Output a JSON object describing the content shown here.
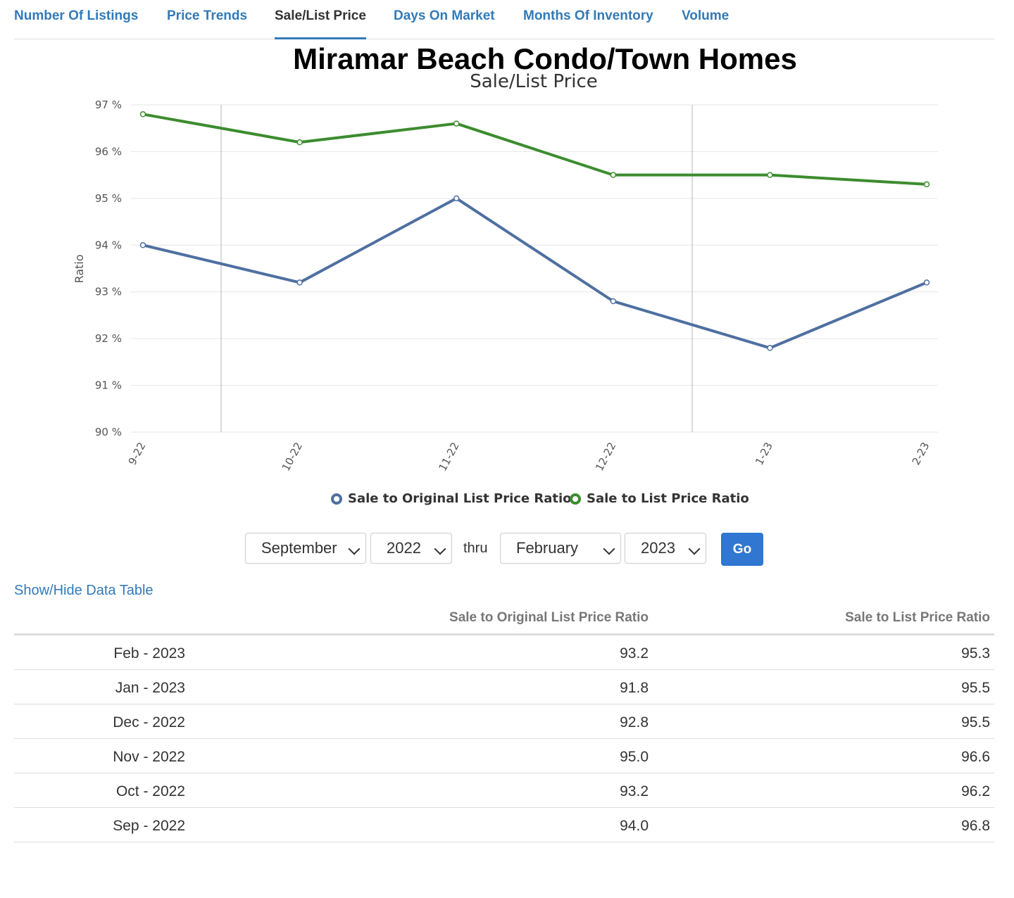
{
  "tabs": [
    {
      "label": "Number Of Listings",
      "active": false
    },
    {
      "label": "Price Trends",
      "active": false
    },
    {
      "label": "Sale/List Price",
      "active": true
    },
    {
      "label": "Days On Market",
      "active": false
    },
    {
      "label": "Months Of Inventory",
      "active": false
    },
    {
      "label": "Volume",
      "active": false
    }
  ],
  "chart_data": {
    "type": "line",
    "title": "Miramar Beach Condo/Town Homes",
    "subtitle": "Sale/List Price",
    "ylabel": "Ratio",
    "xlabel": "",
    "ylim": [
      90,
      97
    ],
    "y_ticks": [
      "90 %",
      "91 %",
      "92 %",
      "93 %",
      "94 %",
      "95 %",
      "96 %",
      "97 %"
    ],
    "categories": [
      "9-22",
      "10-22",
      "11-22",
      "12-22",
      "1-23",
      "2-23"
    ],
    "series": [
      {
        "name": "Sale to Original List Price Ratio",
        "color": "#4e6fa0",
        "values": [
          94.0,
          93.2,
          95.0,
          92.8,
          91.8,
          93.2
        ]
      },
      {
        "name": "Sale to List Price Ratio",
        "color": "#3c8c2e",
        "values": [
          96.8,
          96.2,
          96.6,
          95.5,
          95.5,
          95.3
        ]
      }
    ],
    "grid": true,
    "legend": "bottom-center"
  },
  "controls": {
    "start_month": "September",
    "start_year": "2022",
    "thru_label": "thru",
    "end_month": "February",
    "end_year": "2023",
    "go_label": "Go",
    "icons": {
      "dropdown": "chevron-down-icon",
      "legend_marker": "circle-icon"
    }
  },
  "table_toggle_label": "Show/Hide Data Table",
  "table": {
    "headers": {
      "orig": "Sale to Original List Price Ratio",
      "list": "Sale to List Price Ratio"
    },
    "rows": [
      {
        "date": "Feb - 2023",
        "orig": "93.2",
        "list": "95.3"
      },
      {
        "date": "Jan - 2023",
        "orig": "91.8",
        "list": "95.5"
      },
      {
        "date": "Dec - 2022",
        "orig": "92.8",
        "list": "95.5"
      },
      {
        "date": "Nov - 2022",
        "orig": "95.0",
        "list": "96.6"
      },
      {
        "date": "Oct - 2022",
        "orig": "93.2",
        "list": "96.2"
      },
      {
        "date": "Sep - 2022",
        "orig": "94.0",
        "list": "96.8"
      }
    ]
  }
}
